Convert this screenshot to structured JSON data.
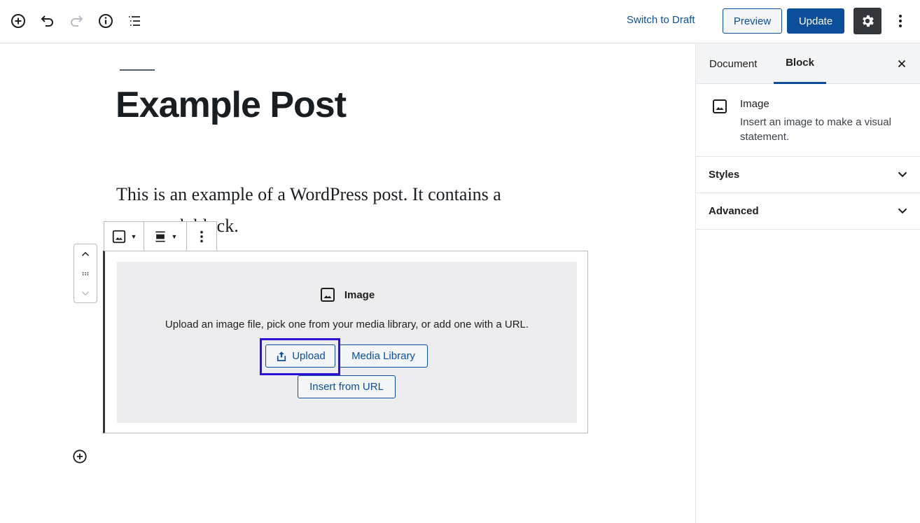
{
  "topbar": {
    "left_icons": [
      "add-block-icon",
      "undo-icon",
      "redo-icon",
      "info-icon",
      "list-view-icon"
    ],
    "switch_to_draft": "Switch to Draft",
    "preview": "Preview",
    "update": "Update",
    "settings_icon": "gear-icon",
    "more_icon": "more-vertical-icon"
  },
  "editor": {
    "title": "Example Post",
    "paragraph": "This is an example of a WordPress post. It contains a paragraph block.",
    "image_block": {
      "label": "Image",
      "instructions": "Upload an image file, pick one from your media library, or add one with a URL.",
      "upload": "Upload",
      "media_library": "Media Library",
      "insert_from_url": "Insert from URL"
    }
  },
  "sidebar": {
    "tabs": [
      {
        "label": "Document",
        "active": false
      },
      {
        "label": "Block",
        "active": true
      }
    ],
    "block_card": {
      "title": "Image",
      "description": "Insert an image to make a visual statement."
    },
    "panels": [
      {
        "title": "Styles",
        "expanded": false
      },
      {
        "title": "Advanced",
        "expanded": false
      }
    ]
  },
  "colors": {
    "accent": "#0b4f9a",
    "highlight": "#2c12d8",
    "settings_bg": "#32373c"
  }
}
